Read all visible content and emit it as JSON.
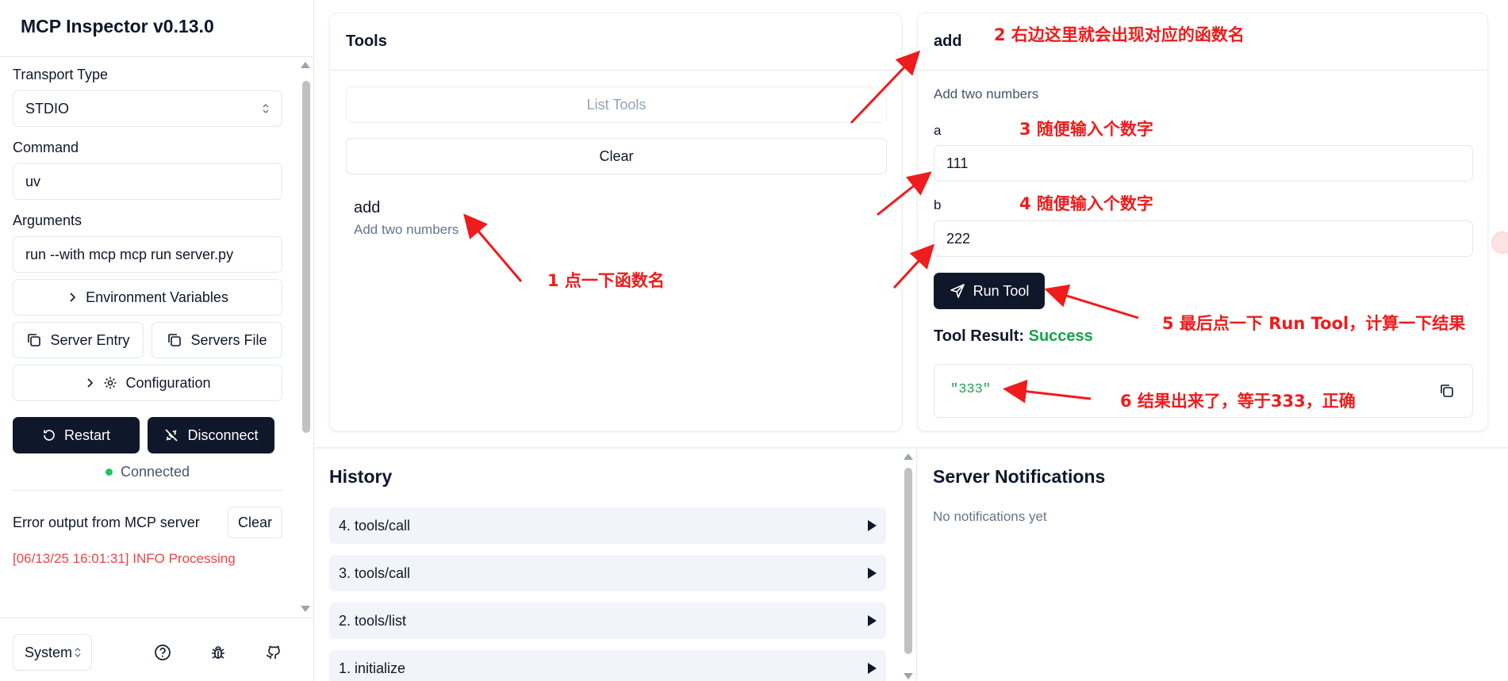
{
  "app": {
    "title": "MCP Inspector v0.13.0"
  },
  "sidebar": {
    "transport_label": "Transport Type",
    "transport_value": "STDIO",
    "command_label": "Command",
    "command_value": "uv",
    "arguments_label": "Arguments",
    "arguments_value": "run --with mcp mcp run server.py",
    "env_vars_label": "Environment Variables",
    "server_entry_label": "Server Entry",
    "servers_file_label": "Servers File",
    "configuration_label": "Configuration",
    "restart_label": "Restart",
    "disconnect_label": "Disconnect",
    "status_text": "Connected",
    "status_color": "#22c55e",
    "error_title": "Error output from MCP server",
    "error_clear_label": "Clear",
    "error_line": "[06/13/25 16:01:31] INFO Processing",
    "theme_value": "System"
  },
  "tools": {
    "title": "Tools",
    "list_button": "List Tools",
    "clear_button": "Clear",
    "items": [
      {
        "name": "add",
        "description": "Add two numbers"
      }
    ]
  },
  "tool_detail": {
    "name": "add",
    "description": "Add two numbers",
    "params": [
      {
        "label": "a",
        "value": "111"
      },
      {
        "label": "b",
        "value": "222"
      }
    ],
    "run_button": "Run Tool",
    "result_label": "Tool Result:",
    "result_status": "Success",
    "result_status_color": "#16a34a",
    "result_value": "\"333\""
  },
  "history": {
    "title": "History",
    "items": [
      {
        "label": "4. tools/call"
      },
      {
        "label": "3. tools/call"
      },
      {
        "label": "2. tools/list"
      },
      {
        "label": "1. initialize"
      }
    ]
  },
  "notifications": {
    "title": "Server Notifications",
    "empty_text": "No notifications yet"
  },
  "annotations": {
    "a1": "1 点一下函数名",
    "a2": "2 右边这里就会出现对应的函数名",
    "a3": "3 随便输入个数字",
    "a4": "4 随便输入个数字",
    "a5": "5 最后点一下 Run Tool，计算一下结果",
    "a6": "6 结果出来了，等于333，正确",
    "color": "#ee1c1c"
  }
}
